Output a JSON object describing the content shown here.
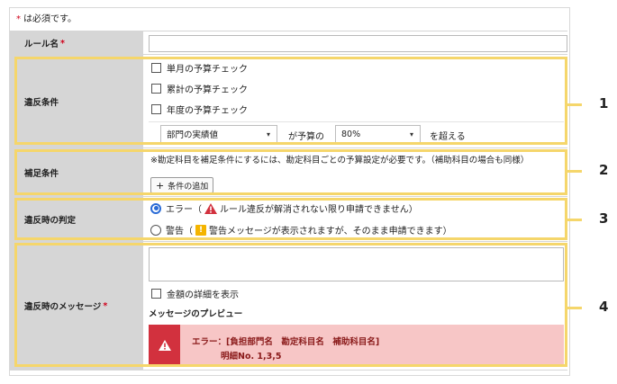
{
  "required_note": "は必須です。",
  "required_mark": "*",
  "rule_name": {
    "label": "ルール名",
    "value": ""
  },
  "violation": {
    "label": "違反条件",
    "checks": [
      {
        "label": "単月の予算チェック",
        "checked": false
      },
      {
        "label": "累計の予算チェック",
        "checked": false
      },
      {
        "label": "年度の予算チェック",
        "checked": false
      }
    ],
    "select1": "部門の実績値",
    "mid_text": "が予算の",
    "select2": "80%",
    "end_text": "を超える"
  },
  "supplement": {
    "label": "補足条件",
    "note": "※勘定科目を補足条件にするには、勘定科目ごとの予算設定が必要です。（補助科目の場合も同様）",
    "add_button": "条件の追加"
  },
  "judgement": {
    "label": "違反時の判定",
    "options": [
      {
        "prefix": "エラー（",
        "text": "ルール違反が解消されない限り申請できません）",
        "selected": true,
        "icon": "alert-triangle-icon"
      },
      {
        "prefix": "警告（",
        "text": "警告メッセージが表示されますが、そのまま申請できます）",
        "selected": false,
        "icon": "warning-icon"
      }
    ]
  },
  "message": {
    "label": "違反時のメッセージ",
    "textarea_value": "",
    "detail_check": "金額の詳細を表示",
    "preview_title": "メッセージのプレビュー",
    "preview_line1": "エラー：[負担部門名　勘定科目名　補助科目名]",
    "preview_line2": "明細No. 1,3,5"
  },
  "callouts": [
    "1",
    "2",
    "3",
    "4"
  ],
  "colors": {
    "required": "#d0021b",
    "callout": "#f5d66b",
    "alert_bg": "#f7c6c6",
    "alert_side": "#d2313e",
    "radio": "#2b6cd6"
  }
}
